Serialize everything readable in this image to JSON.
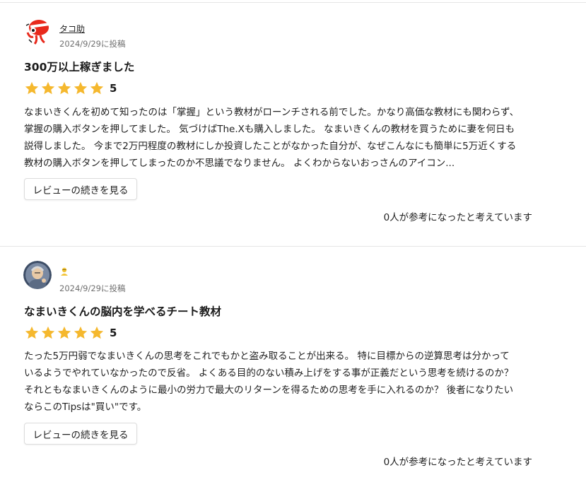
{
  "reviews": [
    {
      "author": "タコ助",
      "date": "2024/9/29に投稿",
      "title": "300万以上稼ぎました",
      "rating": 5,
      "rating_label": "5",
      "body_lines": [
        "なまいきくんを初めて知ったのは「掌握」という教材がローンチされる前でした。かなり高価な教材にも関わらず、",
        "掌握の購入ボタンを押してました。 気づけばThe.Xも購入しました。 なまいきくんの教材を買うために妻を何日も",
        "説得しました。 今まで2万円程度の教材にしか投資したことがなかった自分が、なぜこんなにも簡単に5万近くする",
        "教材の購入ボタンを押してしまったのか不思議でなりません。 よくわからないおっさんのアイコン..."
      ],
      "more_label": "レビューの続きを見る",
      "helpful": "0人が参考になったと考えています",
      "avatar_icon": "red-octopus-avatar"
    },
    {
      "author": "",
      "date": "2024/9/29に投稿",
      "title": "なまいきくんの脳内を学べるチート教材",
      "rating": 5,
      "rating_label": "5",
      "body_lines": [
        "たった5万円弱でなまいきくんの思考をこれでもかと盗み取ることが出来る。 特に目標からの逆算思考は分かって",
        "いるようでやれていなかったので反省。 よくある目的のない積み上げをする事が正義だという思考を続けるのか？",
        "それともなまいきくんのように最小の労力で最大のリターンを得るための思考を手に入れるのか？ 後者になりたい",
        "ならこのTipsは\"買い\"です。"
      ],
      "more_label": "レビューの続きを見る",
      "helpful": "0人が参考になったと考えています",
      "avatar_icon": "old-man-avatar",
      "author_icon": "person-emoji-icon"
    }
  ],
  "colors": {
    "star": "#f5b82e",
    "divider": "#e6e6e6",
    "date_text": "#707070"
  }
}
